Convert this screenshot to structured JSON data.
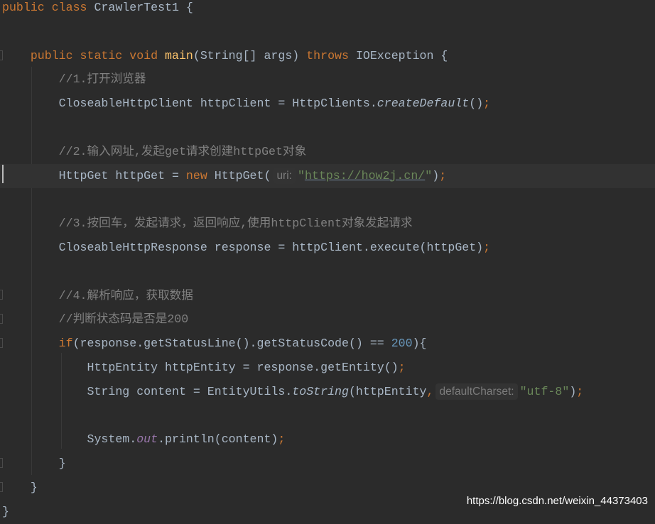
{
  "editor": {
    "current_line": 7,
    "lines": [
      [
        [
          "public class ",
          "k"
        ],
        [
          "CrawlerTest1 {",
          "t"
        ]
      ],
      [],
      [
        [
          "    "
        ],
        [
          "public static void ",
          "k"
        ],
        [
          "main",
          "fn"
        ],
        [
          "(String[] args) ",
          "t"
        ],
        [
          "throws ",
          "k"
        ],
        [
          "IOException {",
          "t"
        ]
      ],
      [
        [
          "        "
        ],
        [
          "//1.打开浏览器",
          "c"
        ]
      ],
      [
        [
          "        "
        ],
        [
          "CloseableHttpClient httpClient = HttpClients.",
          "t"
        ],
        [
          "createDefault",
          "sm"
        ],
        [
          "()",
          "t"
        ],
        [
          ";",
          "k"
        ]
      ],
      [],
      [
        [
          "        "
        ],
        [
          "//2.输入网址,发起get请求创建httpGet对象",
          "c"
        ]
      ],
      [
        [
          "        "
        ],
        [
          "HttpGet httpGet = ",
          "t"
        ],
        [
          "new ",
          "k"
        ],
        [
          "HttpGet(",
          "t"
        ],
        [
          "uri:",
          "hint"
        ],
        [
          "\"",
          "s"
        ],
        [
          "https://how2j.cn/",
          "u"
        ],
        [
          "\"",
          "s"
        ],
        [
          ")",
          "t"
        ],
        [
          ";",
          "k"
        ]
      ],
      [],
      [
        [
          "        "
        ],
        [
          "//3.按回车，发起请求，返回响应,使用httpClient对象发起请求",
          "c"
        ]
      ],
      [
        [
          "        "
        ],
        [
          "CloseableHttpResponse response = httpClient.execute(httpGet)",
          "t"
        ],
        [
          ";",
          "k"
        ]
      ],
      [],
      [
        [
          "        "
        ],
        [
          "//4.解析响应，获取数据",
          "c"
        ]
      ],
      [
        [
          "        "
        ],
        [
          "//判断状态码是否是200",
          "c"
        ]
      ],
      [
        [
          "        "
        ],
        [
          "if",
          "k"
        ],
        [
          "(response.getStatusLine().getStatusCode() == ",
          "t"
        ],
        [
          "200",
          "n"
        ],
        [
          "){",
          "t"
        ]
      ],
      [
        [
          "            "
        ],
        [
          "HttpEntity httpEntity = response.getEntity()",
          "t"
        ],
        [
          ";",
          "k"
        ]
      ],
      [
        [
          "            "
        ],
        [
          "String content = EntityUtils.",
          "t"
        ],
        [
          "toString",
          "sm"
        ],
        [
          "(httpEntity",
          "t"
        ],
        [
          ",",
          "k"
        ],
        [
          "defaultCharset:",
          "hint"
        ],
        [
          "\"utf-8\"",
          "s"
        ],
        [
          ")",
          "t"
        ],
        [
          ";",
          "k"
        ]
      ],
      [],
      [
        [
          "            "
        ],
        [
          "System.",
          "t"
        ],
        [
          "out",
          "sf"
        ],
        [
          ".println(content)",
          "t"
        ],
        [
          ";",
          "k"
        ]
      ],
      [
        [
          "        "
        ],
        [
          "}",
          "t"
        ]
      ],
      [
        [
          "    "
        ],
        [
          "}",
          "t"
        ]
      ],
      [
        [
          "}",
          "t"
        ]
      ]
    ]
  },
  "watermark": "https://blog.csdn.net/weixin_44373403",
  "colors": {
    "background": "#2b2b2b",
    "keyword": "#cc7832",
    "text": "#a9b7c6",
    "comment": "#808080",
    "string": "#6a8759",
    "number": "#6897bb",
    "method_declaration": "#ffc66d",
    "static_field": "#9876aa"
  }
}
